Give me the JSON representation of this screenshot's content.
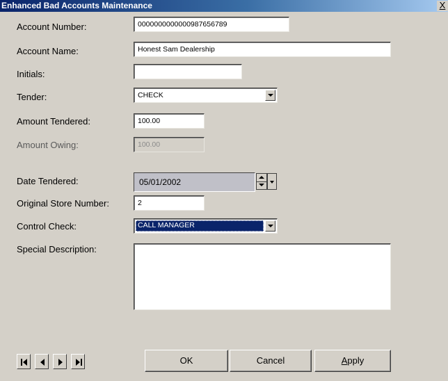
{
  "window": {
    "title": "Enhanced Bad Accounts Maintenance",
    "close_icon": "close-icon",
    "close_glyph": "X"
  },
  "form": {
    "account_number": {
      "label": "Account Number:",
      "value": "0000000000000987656789"
    },
    "account_name": {
      "label": "Account Name:",
      "value": "Honest Sam Dealership"
    },
    "initials": {
      "label": "Initials:",
      "value": ""
    },
    "tender": {
      "label": "Tender:",
      "value": "CHECK"
    },
    "amount_tendered": {
      "label": "Amount Tendered:",
      "value": "100.00"
    },
    "amount_owing": {
      "label": "Amount Owing:",
      "value": "100.00"
    },
    "date_tendered": {
      "label": "Date Tendered:",
      "value": "05/01/2002"
    },
    "original_store_number": {
      "label": "Original Store Number:",
      "value": "2"
    },
    "control_check": {
      "label": "Control Check:",
      "value": "CALL MANAGER"
    },
    "special_description": {
      "label": "Special Description:",
      "value": ""
    }
  },
  "buttons": {
    "ok": "OK",
    "cancel": "Cancel",
    "apply": "Apply"
  },
  "navigation": {
    "icons": [
      "first-record-icon",
      "previous-record-icon",
      "next-record-icon",
      "last-record-icon"
    ]
  },
  "colors": {
    "titlebar_start": "#0a246a",
    "titlebar_end": "#a6caf0",
    "dialog_bg": "#d4d0c8",
    "selection_bg": "#0a246a"
  }
}
